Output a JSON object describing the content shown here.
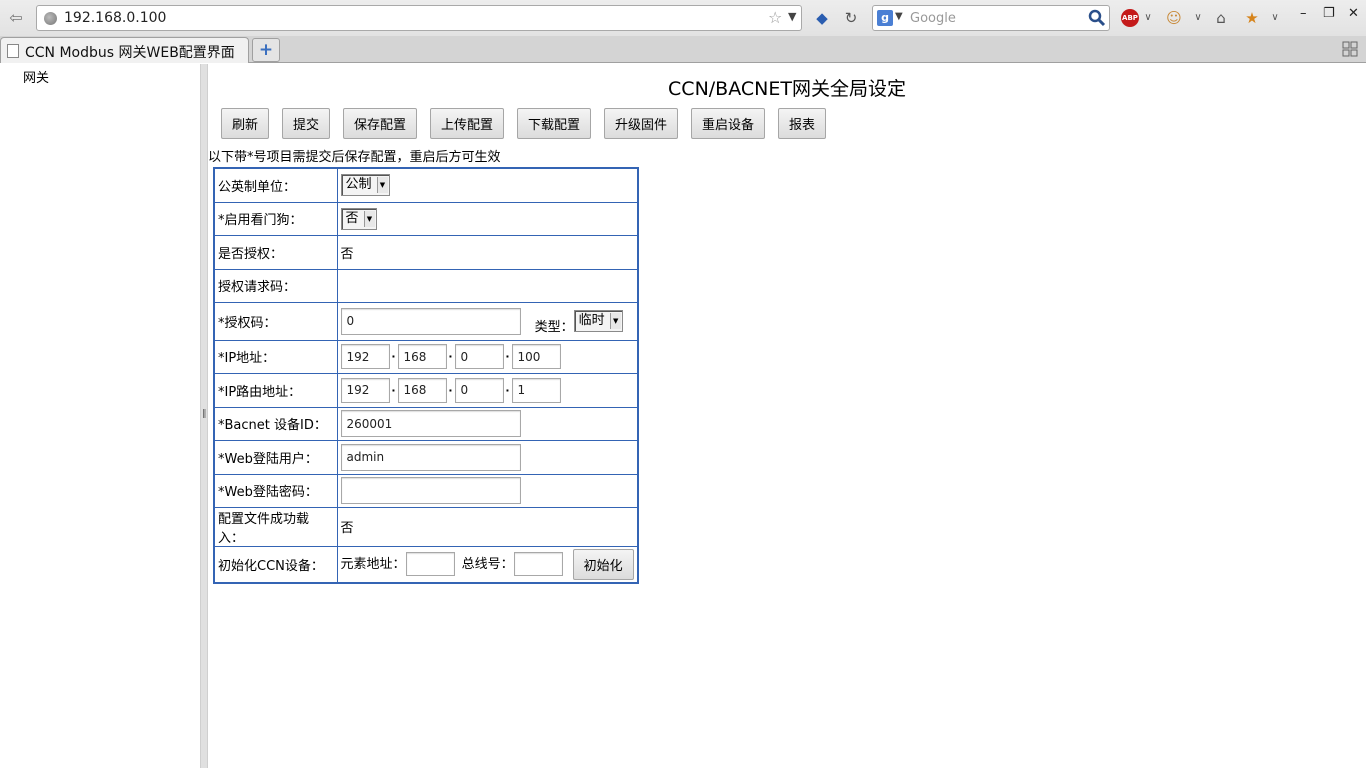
{
  "browser": {
    "url": "192.168.0.100",
    "search_placeholder": "Google",
    "tab_title": "CCN Modbus 网关WEB配置界面",
    "new_tab_symbol": "+"
  },
  "nav": {
    "items": [
      "网关"
    ]
  },
  "page": {
    "title": "CCN/BACNET网关全局设定",
    "buttons": [
      "刷新",
      "提交",
      "保存配置",
      "上传配置",
      "下载配置",
      "升级固件",
      "重启设备",
      "报表"
    ],
    "notice": "以下带*号项目需提交后保存配置，重启后方可生效"
  },
  "form": {
    "unit": {
      "label": "公英制单位：",
      "value": "公制"
    },
    "watchdog": {
      "label": "*启用看门狗：",
      "value": "否"
    },
    "authorized": {
      "label": "是否授权：",
      "value": "否"
    },
    "auth_request_code": {
      "label": "授权请求码：",
      "value": ""
    },
    "auth_code": {
      "label": "*授权码：",
      "value": "0",
      "type_label": "类型：",
      "type_value": "临时"
    },
    "ip": {
      "label": "*IP地址：",
      "octets": [
        "192",
        "168",
        "0",
        "100"
      ]
    },
    "gateway": {
      "label": "*IP路由地址：",
      "octets": [
        "192",
        "168",
        "0",
        "1"
      ]
    },
    "bacnet_id": {
      "label": "*Bacnet 设备ID：",
      "value": "260001"
    },
    "web_user": {
      "label": "*Web登陆用户：",
      "value": "admin"
    },
    "web_password": {
      "label": "*Web登陆密码：",
      "value": ""
    },
    "config_loaded": {
      "label": "配置文件成功载入：",
      "value": "否"
    },
    "init_ccn": {
      "label": "初始化CCN设备：",
      "element_label": "元素地址：",
      "bus_label": "总线号：",
      "button": "初始化"
    }
  }
}
